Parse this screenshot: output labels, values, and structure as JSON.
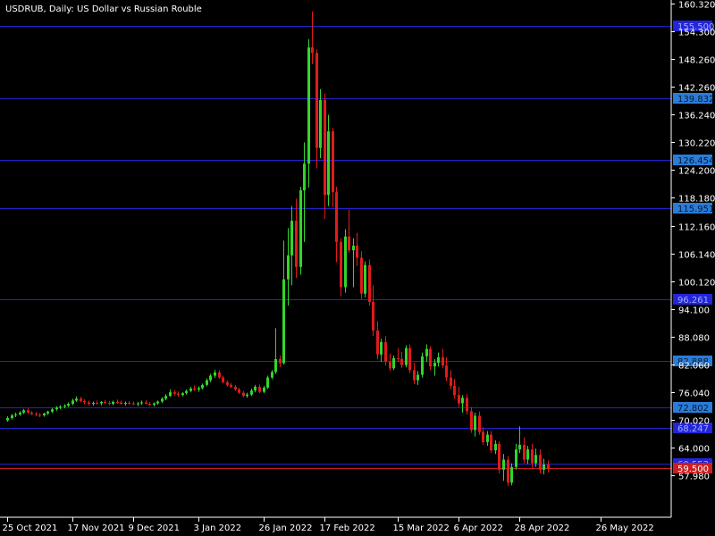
{
  "chart_data": {
    "type": "candlestick",
    "title": "USDRUB, Daily:  US Dollar vs Russian Rouble",
    "colors": {
      "background": "#000000",
      "axis": "#ffffff",
      "bull": "#31d62c",
      "bear": "#e11b1b",
      "level_line": "#2222cc",
      "level_label_bg": "#2b7cd8",
      "current_line": "#cc1e1e",
      "current_label_bg": "#cc1e1e"
    },
    "ylim": [
      54.9,
      160.32
    ],
    "y_ticks": [
      "160.320",
      "154.300",
      "148.260",
      "142.260",
      "136.240",
      "130.220",
      "124.200",
      "118.180",
      "112.160",
      "106.140",
      "100.120",
      "94.100",
      "88.080",
      "82.060",
      "76.040",
      "70.020",
      "64.000",
      "57.980"
    ],
    "x_ticks": [
      "25 Oct 2021",
      "17 Nov 2021",
      "9 Dec 2021",
      "3 Jan 2022",
      "26 Jan 2022",
      "17 Feb 2022",
      "15 Mar 2022",
      "6 Apr 2022",
      "28 Apr 2022",
      "26 May 2022"
    ],
    "x_tick_index": [
      0,
      16,
      31,
      47,
      63,
      78,
      96,
      111,
      126,
      146
    ],
    "levels": [
      {
        "price": 155.5,
        "label": "155.500"
      },
      {
        "price": 139.832,
        "label": "139.832"
      },
      {
        "price": 126.454,
        "label": "126.454"
      },
      {
        "price": 115.951,
        "label": "115.951"
      },
      {
        "price": 96.261,
        "label": "96.261"
      },
      {
        "price": 82.888,
        "label": "82.888"
      },
      {
        "price": 72.802,
        "label": "72.802"
      },
      {
        "price": 68.247,
        "label": "68.247"
      },
      {
        "price": 60.553,
        "label": "60.553"
      }
    ],
    "current_price": {
      "price": 59.5,
      "label": "59.500"
    },
    "candles": [
      [
        69.9,
        70.8,
        69.6,
        70.4
      ],
      [
        70.4,
        71.3,
        70.1,
        71.0
      ],
      [
        71.0,
        71.6,
        70.6,
        71.2
      ],
      [
        71.2,
        71.9,
        70.9,
        71.6
      ],
      [
        71.6,
        72.4,
        71.3,
        72.1
      ],
      [
        72.1,
        72.5,
        71.3,
        71.6
      ],
      [
        71.6,
        71.9,
        71.0,
        71.3
      ],
      [
        71.3,
        71.7,
        70.8,
        71.1
      ],
      [
        71.1,
        71.5,
        70.6,
        71.0
      ],
      [
        71.0,
        71.6,
        70.7,
        71.4
      ],
      [
        71.4,
        72.0,
        71.1,
        71.8
      ],
      [
        71.8,
        72.6,
        71.5,
        72.3
      ],
      [
        72.3,
        73.0,
        72.0,
        72.7
      ],
      [
        72.7,
        73.2,
        72.3,
        72.9
      ],
      [
        72.9,
        73.4,
        72.5,
        73.1
      ],
      [
        73.1,
        73.8,
        72.8,
        73.5
      ],
      [
        73.5,
        74.6,
        73.2,
        74.2
      ],
      [
        74.2,
        75.1,
        73.9,
        74.6
      ],
      [
        74.6,
        75.0,
        73.8,
        74.1
      ],
      [
        74.1,
        74.5,
        73.4,
        73.8
      ],
      [
        73.8,
        74.2,
        73.1,
        73.5
      ],
      [
        73.5,
        74.0,
        73.1,
        73.7
      ],
      [
        73.7,
        74.2,
        73.3,
        73.6
      ],
      [
        73.6,
        74.1,
        73.2,
        73.9
      ],
      [
        73.9,
        74.3,
        73.4,
        73.7
      ],
      [
        73.7,
        74.1,
        73.2,
        73.5
      ],
      [
        73.5,
        74.2,
        73.2,
        73.9
      ],
      [
        73.9,
        74.4,
        73.5,
        73.8
      ],
      [
        73.8,
        74.2,
        73.3,
        73.5
      ],
      [
        73.5,
        74.0,
        73.1,
        73.7
      ],
      [
        73.7,
        74.1,
        73.3,
        73.6
      ],
      [
        73.6,
        74.0,
        73.2,
        73.4
      ],
      [
        73.4,
        73.9,
        73.0,
        73.6
      ],
      [
        73.6,
        74.2,
        73.3,
        73.8
      ],
      [
        73.8,
        74.3,
        73.4,
        73.5
      ],
      [
        73.5,
        73.9,
        73.0,
        73.3
      ],
      [
        73.3,
        73.8,
        72.9,
        73.6
      ],
      [
        73.6,
        74.2,
        73.3,
        74.0
      ],
      [
        74.0,
        74.9,
        73.7,
        74.6
      ],
      [
        74.6,
        75.6,
        74.3,
        75.2
      ],
      [
        75.2,
        76.6,
        75.0,
        76.0
      ],
      [
        76.0,
        76.5,
        75.3,
        75.7
      ],
      [
        75.7,
        76.2,
        75.0,
        75.4
      ],
      [
        75.4,
        76.0,
        75.1,
        75.8
      ],
      [
        75.8,
        76.6,
        75.5,
        76.3
      ],
      [
        76.3,
        77.2,
        76.0,
        76.8
      ],
      [
        76.8,
        77.5,
        76.3,
        76.6
      ],
      [
        76.6,
        77.3,
        76.1,
        76.9
      ],
      [
        76.9,
        77.9,
        76.6,
        77.6
      ],
      [
        77.6,
        79.0,
        77.3,
        78.6
      ],
      [
        78.6,
        80.0,
        78.2,
        79.6
      ],
      [
        79.6,
        80.9,
        79.1,
        80.3
      ],
      [
        80.3,
        80.8,
        78.9,
        79.2
      ],
      [
        79.2,
        79.6,
        77.9,
        78.2
      ],
      [
        78.2,
        78.6,
        77.2,
        77.6
      ],
      [
        77.6,
        78.0,
        76.9,
        77.2
      ],
      [
        77.2,
        77.6,
        76.3,
        76.6
      ],
      [
        76.6,
        77.0,
        75.6,
        75.9
      ],
      [
        75.9,
        76.3,
        74.9,
        75.2
      ],
      [
        75.2,
        75.9,
        74.8,
        75.5
      ],
      [
        75.5,
        76.8,
        75.2,
        76.4
      ],
      [
        76.4,
        77.6,
        76.0,
        77.2
      ],
      [
        77.2,
        77.7,
        75.8,
        76.1
      ],
      [
        76.1,
        77.4,
        75.8,
        77.0
      ],
      [
        77.0,
        79.6,
        76.7,
        79.2
      ],
      [
        79.2,
        80.8,
        78.8,
        80.4
      ],
      [
        80.4,
        89.9,
        80.0,
        83.2
      ],
      [
        83.2,
        84.0,
        81.5,
        82.3
      ],
      [
        82.3,
        108.9,
        82.0,
        100.5
      ],
      [
        100.5,
        111.6,
        94.8,
        105.7
      ],
      [
        105.7,
        116.4,
        99.2,
        113.2
      ],
      [
        113.2,
        118.0,
        100.8,
        103.2
      ],
      [
        103.2,
        120.6,
        101.5,
        119.8
      ],
      [
        119.8,
        130.2,
        108.6,
        125.6
      ],
      [
        125.6,
        152.6,
        120.4,
        150.8
      ],
      [
        150.8,
        158.6,
        147.2,
        149.6
      ],
      [
        149.6,
        150.4,
        124.6,
        129.0
      ],
      [
        129.0,
        141.8,
        126.8,
        139.4
      ],
      [
        139.4,
        140.8,
        113.6,
        118.8
      ],
      [
        118.8,
        136.2,
        116.4,
        132.6
      ],
      [
        132.6,
        133.4,
        116.2,
        119.4
      ],
      [
        119.4,
        120.6,
        104.2,
        108.6
      ],
      [
        108.6,
        109.4,
        96.8,
        98.8
      ],
      [
        98.8,
        111.4,
        97.6,
        109.8
      ],
      [
        109.8,
        115.6,
        106.2,
        106.8
      ],
      [
        106.8,
        109.4,
        98.8,
        107.8
      ],
      [
        107.8,
        110.6,
        103.4,
        105.2
      ],
      [
        105.2,
        106.6,
        96.2,
        97.4
      ],
      [
        97.4,
        104.4,
        96.6,
        103.6
      ],
      [
        103.6,
        104.8,
        94.8,
        95.6
      ],
      [
        95.6,
        99.2,
        88.2,
        89.4
      ],
      [
        89.4,
        91.4,
        83.2,
        84.2
      ],
      [
        84.2,
        87.6,
        82.6,
        86.9
      ],
      [
        86.9,
        88.2,
        81.8,
        82.6
      ],
      [
        82.6,
        84.4,
        80.6,
        81.2
      ],
      [
        81.2,
        84.0,
        80.8,
        83.4
      ],
      [
        83.4,
        85.6,
        82.6,
        83.2
      ],
      [
        83.2,
        84.8,
        81.2,
        81.9
      ],
      [
        81.9,
        86.2,
        81.4,
        85.6
      ],
      [
        85.6,
        86.4,
        80.2,
        80.8
      ],
      [
        80.8,
        82.4,
        77.8,
        78.6
      ],
      [
        78.6,
        80.6,
        77.6,
        79.8
      ],
      [
        79.8,
        84.6,
        79.2,
        83.8
      ],
      [
        83.8,
        86.4,
        82.6,
        85.4
      ],
      [
        85.4,
        86.0,
        80.8,
        81.6
      ],
      [
        81.6,
        83.2,
        79.6,
        82.4
      ],
      [
        82.4,
        84.6,
        81.6,
        83.6
      ],
      [
        83.6,
        85.4,
        81.2,
        81.8
      ],
      [
        81.8,
        83.6,
        78.4,
        79.2
      ],
      [
        79.2,
        80.8,
        76.6,
        77.4
      ],
      [
        77.4,
        78.8,
        74.6,
        75.4
      ],
      [
        75.4,
        77.2,
        72.8,
        73.6
      ],
      [
        73.6,
        75.4,
        71.6,
        74.8
      ],
      [
        74.8,
        75.6,
        71.2,
        71.9
      ],
      [
        71.9,
        72.8,
        67.2,
        67.8
      ],
      [
        67.8,
        71.6,
        66.4,
        70.9
      ],
      [
        70.9,
        71.8,
        66.8,
        67.4
      ],
      [
        67.4,
        68.4,
        64.6,
        65.2
      ],
      [
        65.2,
        67.6,
        64.4,
        66.8
      ],
      [
        66.8,
        67.6,
        62.8,
        63.4
      ],
      [
        63.4,
        65.6,
        62.6,
        64.8
      ],
      [
        64.8,
        65.4,
        58.4,
        59.2
      ],
      [
        59.2,
        62.6,
        56.8,
        61.4
      ],
      [
        61.4,
        62.2,
        55.6,
        56.4
      ],
      [
        56.4,
        60.6,
        55.8,
        59.8
      ],
      [
        59.8,
        64.8,
        59.2,
        63.6
      ],
      [
        63.6,
        68.6,
        62.8,
        64.6
      ],
      [
        64.6,
        66.2,
        60.6,
        61.4
      ],
      [
        61.4,
        64.4,
        60.4,
        63.6
      ],
      [
        63.6,
        64.8,
        59.6,
        60.6
      ],
      [
        60.6,
        63.8,
        59.8,
        62.4
      ],
      [
        62.4,
        63.6,
        58.4,
        59.2
      ],
      [
        59.2,
        61.6,
        58.2,
        60.3
      ],
      [
        60.3,
        61.2,
        58.6,
        59.5
      ]
    ]
  }
}
